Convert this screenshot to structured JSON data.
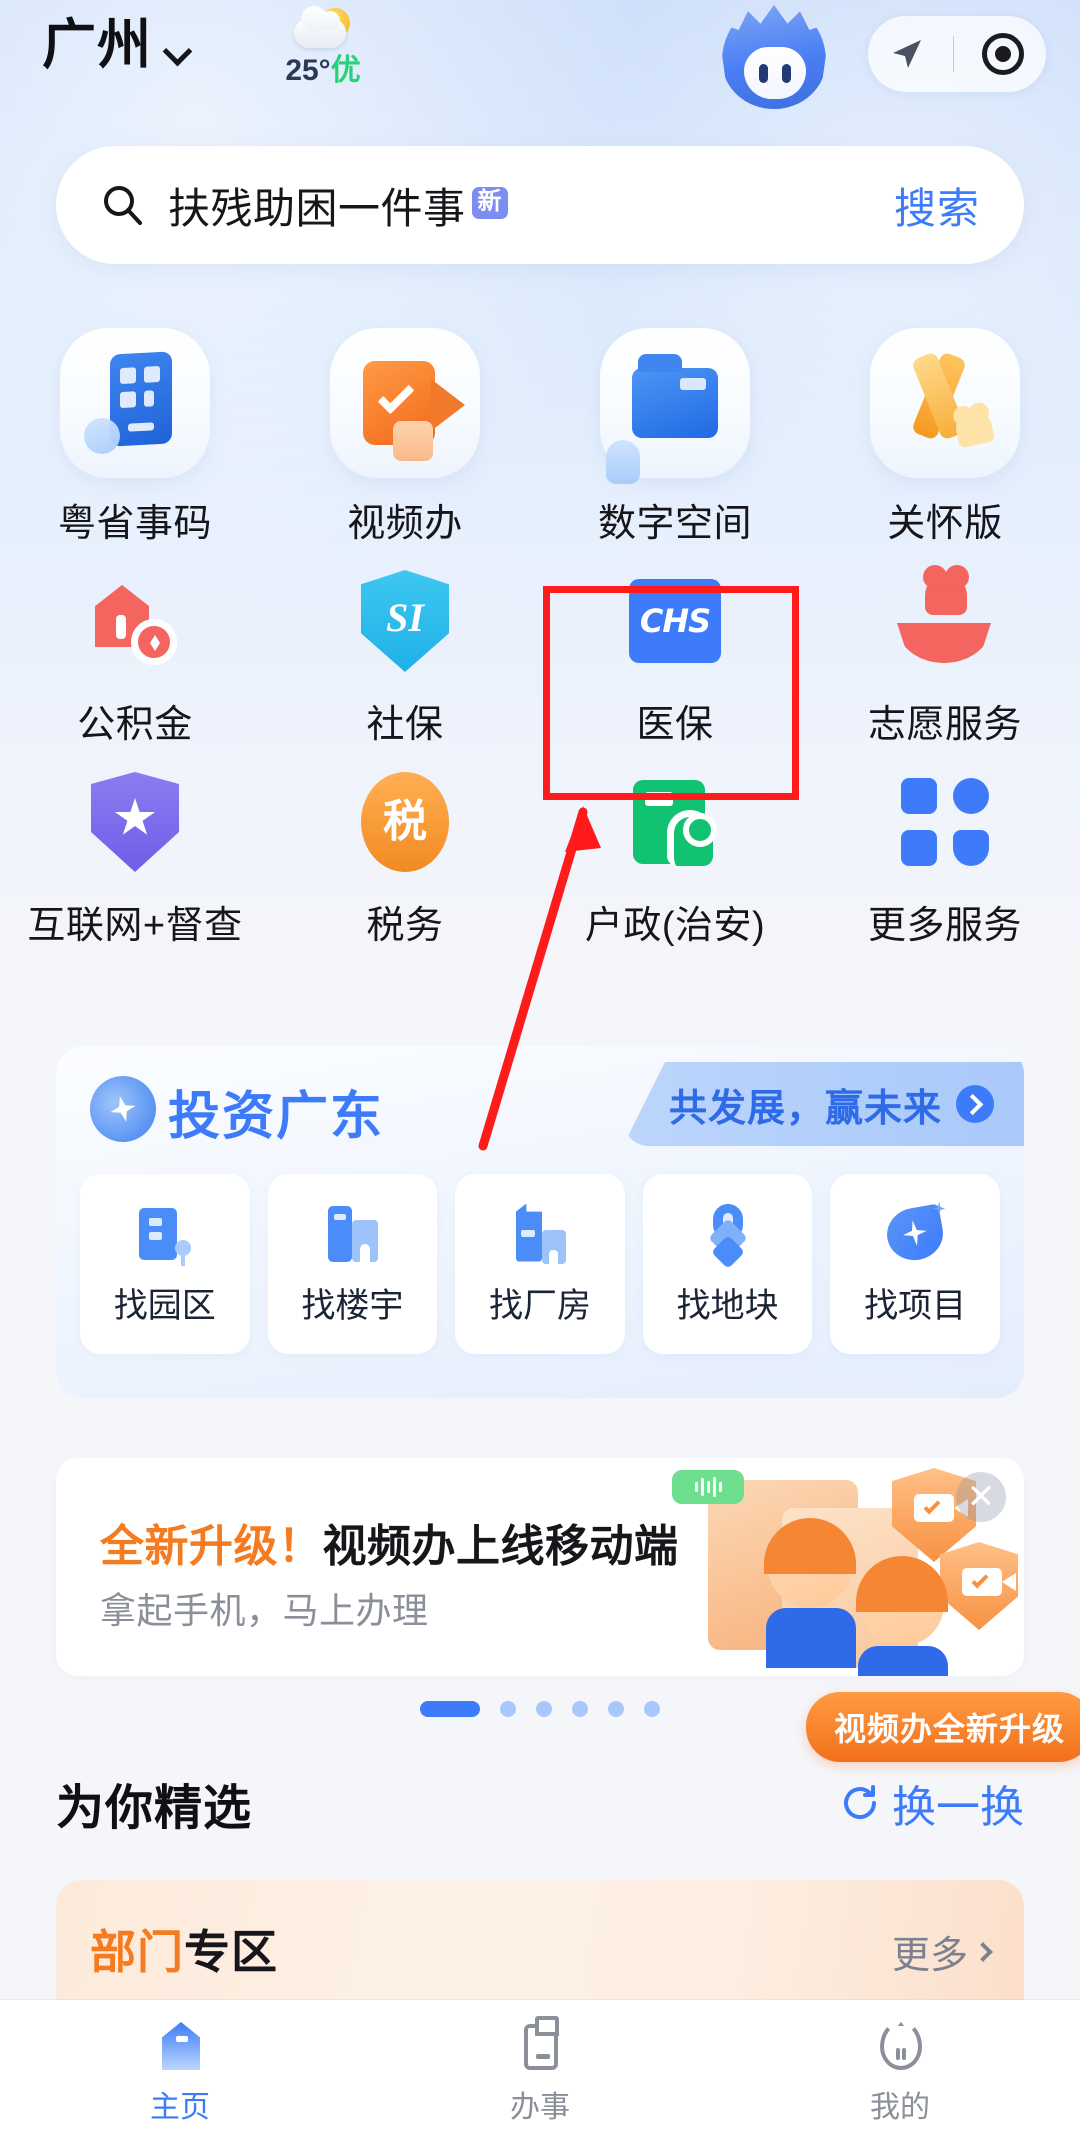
{
  "header": {
    "city": "广州",
    "city_chevron_icon": "chevron-down-icon",
    "weather": {
      "icon": "sun-behind-cloud-icon",
      "temperature": "25°",
      "air_quality": "优"
    },
    "mascot_icon": "mascot-avatar-icon",
    "location_pill": {
      "navigate_icon": "navigation-arrow-icon",
      "record_icon": "record-target-icon"
    }
  },
  "search": {
    "icon": "search-icon",
    "query": "扶残助困一件事",
    "badge": "新",
    "button": "搜索"
  },
  "grid": {
    "rows": [
      [
        {
          "label": "粤省事码",
          "icon": "id-code-card-icon"
        },
        {
          "label": "视频办",
          "icon": "video-service-icon"
        },
        {
          "label": "数字空间",
          "icon": "digital-space-folder-icon"
        },
        {
          "label": "关怀版",
          "icon": "care-ribbon-icon"
        }
      ],
      [
        {
          "label": "公积金",
          "icon": "housing-fund-house-icon"
        },
        {
          "label": "社保",
          "icon": "social-insurance-si-shield-icon"
        },
        {
          "label": "医保",
          "icon": "medical-insurance-chs-icon"
        },
        {
          "label": "志愿服务",
          "icon": "volunteer-heart-hand-icon"
        }
      ],
      [
        {
          "label": "互联网+督查",
          "icon": "supervision-star-shield-icon"
        },
        {
          "label": "税务",
          "icon": "tax-circle-icon"
        },
        {
          "label": "户政(治安)",
          "icon": "household-police-card-icon"
        },
        {
          "label": "更多服务",
          "icon": "more-services-grid-icon"
        }
      ]
    ]
  },
  "invest": {
    "logo_icon": "invest-guangdong-logo-icon",
    "title": "投资广东",
    "tagline": "共发展，赢未来",
    "tagline_arrow_icon": "chevron-right-circle-icon",
    "items": [
      {
        "label": "找园区",
        "icon": "industrial-park-icon"
      },
      {
        "label": "找楼宇",
        "icon": "office-building-icon"
      },
      {
        "label": "找厂房",
        "icon": "factory-icon"
      },
      {
        "label": "找地块",
        "icon": "land-parcel-pin-icon"
      },
      {
        "label": "找项目",
        "icon": "project-sparkle-icon"
      }
    ]
  },
  "promo": {
    "title_highlight": "全新升级！",
    "title_rest": "视频办上线移动端",
    "subtitle": "拿起手机，马上办理",
    "close_icon": "close-icon",
    "badge": "视频办全新升级",
    "pagination": {
      "total": 6,
      "active_index": 0
    }
  },
  "picks": {
    "title": "为你精选",
    "refresh_icon": "refresh-icon",
    "refresh_label": "换一换"
  },
  "department": {
    "title_orange": "部门",
    "title_black": "专区",
    "more_label": "更多",
    "more_icon": "chevron-right-icon"
  },
  "tabbar": {
    "tabs": [
      {
        "label": "主页",
        "icon": "home-icon",
        "active": true
      },
      {
        "label": "办事",
        "icon": "clipboard-icon",
        "active": false
      },
      {
        "label": "我的",
        "icon": "profile-mascot-icon",
        "active": false
      }
    ]
  },
  "annotation": {
    "highlight_target": "医保",
    "box_color": "#ff1b1b",
    "arrow_color": "#ff1b1b"
  },
  "colors": {
    "accent_blue": "#3d7bfb",
    "accent_orange": "#f47b20",
    "aqi_green": "#29d07a",
    "badge_purple": "#7c8cf0"
  }
}
